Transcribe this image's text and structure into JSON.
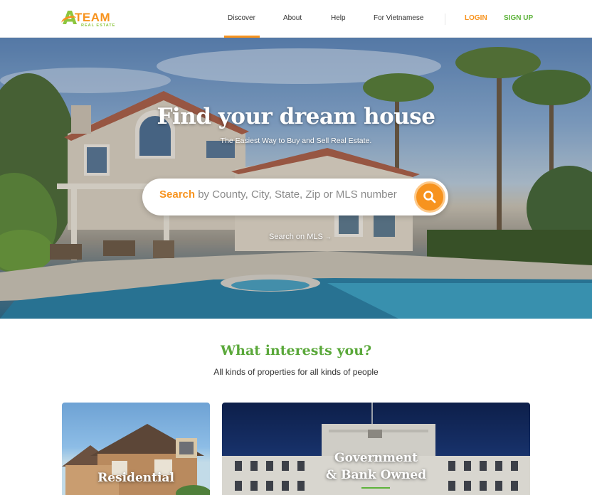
{
  "brand": {
    "logo_letter": "A",
    "logo_word": "TEAM",
    "logo_sub": "REAL ESTATE",
    "orange": "#f7931e",
    "green": "#5db33a"
  },
  "nav": {
    "items": [
      {
        "label": "Discover",
        "active": true
      },
      {
        "label": "About"
      },
      {
        "label": "Help"
      },
      {
        "label": "For Vietnamese"
      }
    ],
    "login": "LOGIN",
    "signup": "SIGN UP"
  },
  "hero": {
    "title": "Find your dream house",
    "subtitle": "The Easiest Way to Buy and Sell Real Estate.",
    "search_prefix": "Search",
    "search_placeholder": "by County, City, State, Zip or MLS number",
    "search_icon": "search-icon",
    "mls_link": "Search on MLS",
    "mls_arrow": "→"
  },
  "interests": {
    "title": "What interests you?",
    "subtitle": "All kinds of properties for all kinds of people",
    "cards": [
      {
        "label": "Residential"
      },
      {
        "label_line1": "Government",
        "label_line2": "& Bank Owned"
      }
    ]
  }
}
